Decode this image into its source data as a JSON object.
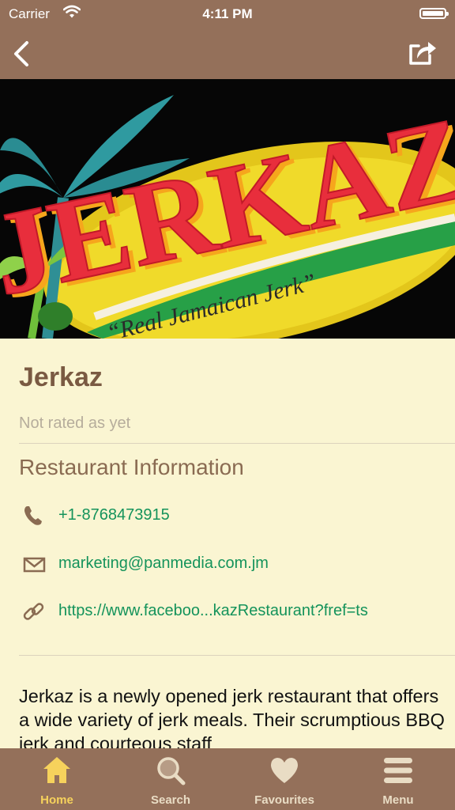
{
  "status_bar": {
    "carrier": "Carrier",
    "time": "4:11 PM"
  },
  "nav": {
    "back_icon": "chevron-left-icon",
    "share_icon": "share-icon"
  },
  "hero": {
    "logo_text": "JERKAZ",
    "tagline": "“Real Jamaican Jerk”"
  },
  "restaurant": {
    "name": "Jerkaz",
    "rating_text": "Not rated as yet",
    "section_title": "Restaurant Information",
    "phone": "+1-8768473915",
    "email": "marketing@panmedia.com.jm",
    "website": "https://www.faceboo...kazRestaurant?fref=ts",
    "description": "Jerkaz is a newly opened jerk restaurant that offers a wide variety of jerk meals. Their scrumptious BBQ jerk and courteous staff"
  },
  "tabs": [
    {
      "label": "Home",
      "icon": "home-icon",
      "active": true
    },
    {
      "label": "Search",
      "icon": "search-icon",
      "active": false
    },
    {
      "label": "Favourites",
      "icon": "heart-icon",
      "active": false
    },
    {
      "label": "Menu",
      "icon": "menu-icon",
      "active": false
    }
  ],
  "colors": {
    "bar": "#94705a",
    "background": "#faf5d2",
    "link": "#14935b",
    "active_tab": "#f6d25c"
  }
}
